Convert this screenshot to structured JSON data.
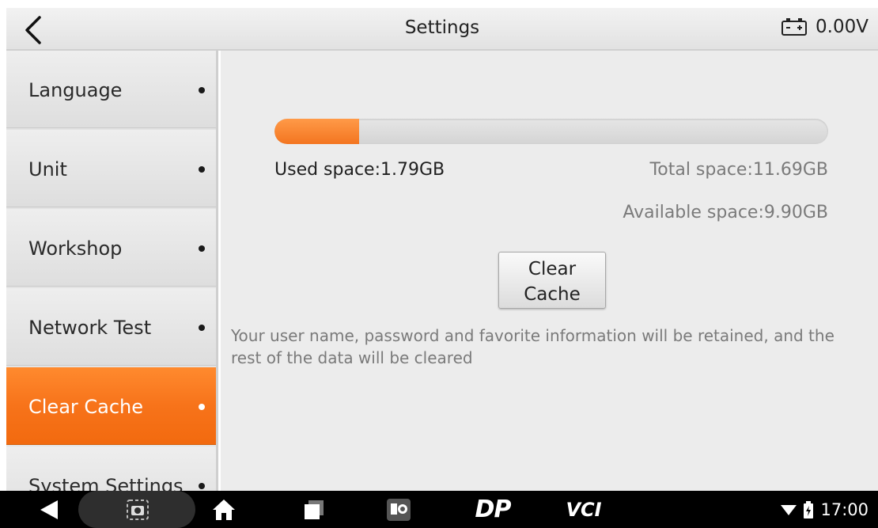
{
  "header": {
    "title": "Settings",
    "battery_voltage": "0.00V",
    "back_icon": "chevron-left-icon",
    "battery_icon": "car-battery-icon"
  },
  "sidebar": {
    "items": [
      {
        "label": "Language",
        "active": false
      },
      {
        "label": "Unit",
        "active": false
      },
      {
        "label": "Workshop",
        "active": false
      },
      {
        "label": "Network Test",
        "active": false
      },
      {
        "label": "Clear Cache",
        "active": true
      },
      {
        "label": "System Settings",
        "active": false
      }
    ],
    "accent_color": "#f7731a"
  },
  "storage": {
    "used_label": "Used space:1.79GB",
    "total_label": "Total space:11.69GB",
    "available_label": "Available space:9.90GB",
    "used_fraction": 0.153,
    "bar_color": "#f37520"
  },
  "clear_button": {
    "line1": "Clear",
    "line2": "Cache"
  },
  "notice": "Your user name, password and favorite information will be retained, and the rest of the data will be cleared",
  "navbar": {
    "icons": [
      "back-triangle-icon",
      "screenshot-icon",
      "home-icon",
      "recents-icon",
      "app-icon",
      "dp-icon",
      "vci-icon"
    ],
    "dp_text": "DP",
    "vci_text": "VCI",
    "time": "17:00",
    "status_icons": [
      "wifi-icon",
      "battery-icon"
    ]
  }
}
